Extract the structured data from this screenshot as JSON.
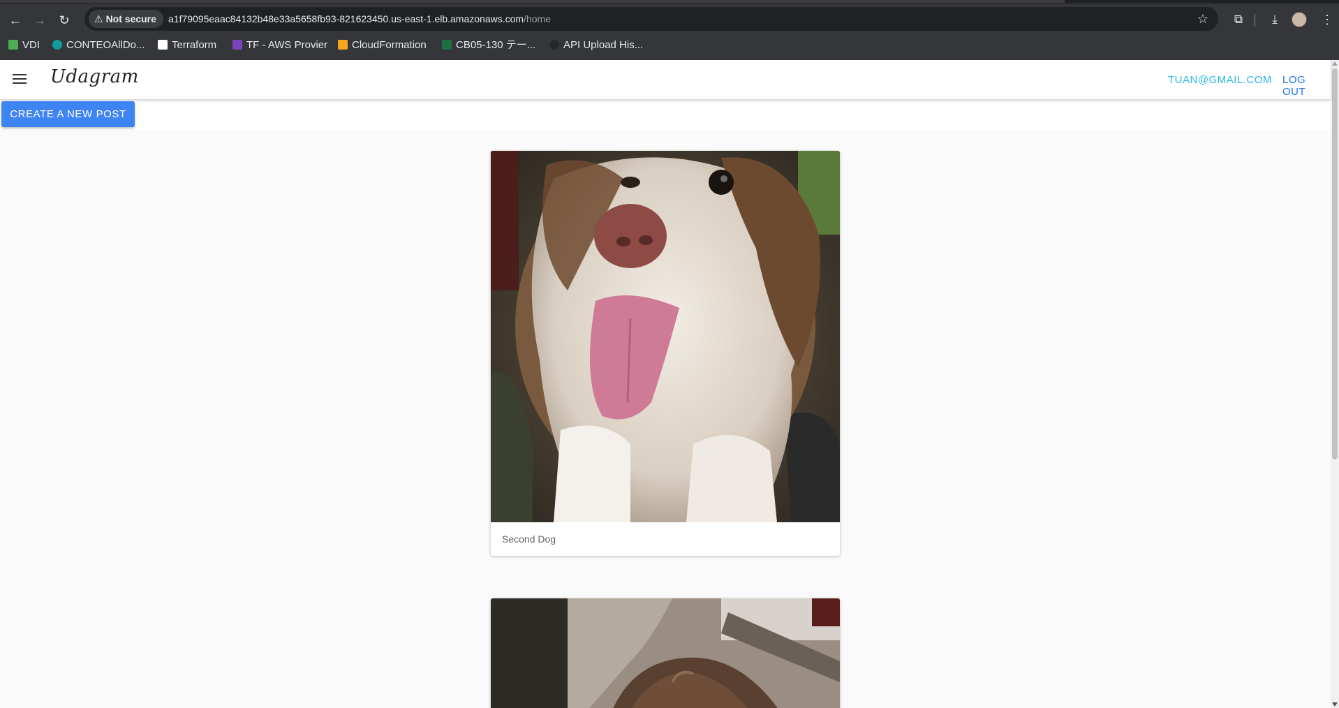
{
  "browser": {
    "security_label": "Not secure",
    "url_host": "a1f79095eaac84132b48e33a5658fb93-821623450.us-east-1.elb.amazonaws.com",
    "url_path": "/home",
    "bookmarks": [
      {
        "label": "VDI",
        "color": "#4caf50"
      },
      {
        "label": "CONTEOAllDo...",
        "color": "#0f9d9a"
      },
      {
        "label": "Terraform",
        "color": "#ffffff"
      },
      {
        "label": "TF - AWS Provier",
        "color": "#7b42bc"
      },
      {
        "label": "CloudFormation",
        "color": "#f4a81d"
      },
      {
        "label": "CB05-130 テー...",
        "color": "#1d6f42"
      },
      {
        "label": "API Upload His...",
        "color": "#24292e"
      }
    ]
  },
  "app": {
    "brand": "Udagram",
    "user_email": "TUAN@GMAIL.COM",
    "logout_label": "LOG OUT",
    "create_post_label": "CREATE A NEW POST"
  },
  "feed": {
    "posts": [
      {
        "caption": "Second Dog",
        "image": "dog-photo-1"
      },
      {
        "caption": "",
        "image": "dog-photo-2"
      }
    ]
  },
  "colors": {
    "accent": "#3f84f3",
    "email_link": "#2ab7e4",
    "logout_link": "#1a73e8"
  }
}
